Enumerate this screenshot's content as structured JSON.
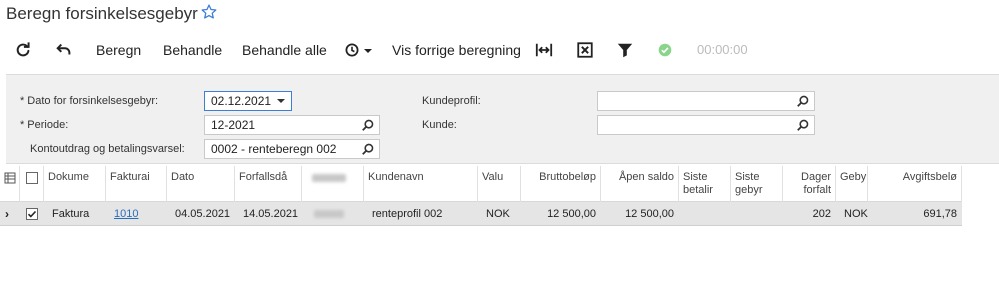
{
  "header": {
    "title": "Beregn forsinkelsesgebyr"
  },
  "toolbar": {
    "refresh_icon": "refresh-icon",
    "undo_icon": "undo-icon",
    "beregn_label": "Beregn",
    "behandle_label": "Behandle",
    "behandle_alle_label": "Behandle alle",
    "schedule_icon": "schedule-icon",
    "vis_forrige_label": "Vis forrige beregning",
    "fit_icon": "fit-columns-icon",
    "export_icon": "export-excel-icon",
    "filter_icon": "filter-icon",
    "status_icon": "check-circle-icon",
    "timer": "00:00:00"
  },
  "form": {
    "dato_label": "Dato for forsinkelsesgebyr:",
    "dato_value": "02.12.2021",
    "periode_label": "Periode:",
    "periode_value": "12-2021",
    "kontoutdrag_label": "Kontoutdrag og betalingsvarsel:",
    "kontoutdrag_value": "0002 - renteberegn 002",
    "kundeprofil_label": "Kundeprofil:",
    "kundeprofil_value": "",
    "kunde_label": "Kunde:",
    "kunde_value": "",
    "required_marker": "*"
  },
  "grid": {
    "columns": {
      "dokument": "Dokume",
      "faktura": "Fakturai",
      "dato": "Dato",
      "forfall": "Forfallsdå",
      "kundenavn": "Kundenavn",
      "valuta": "Valu",
      "brutto": "Bruttobeløp",
      "apen": "Åpen saldo",
      "siste_betaling": "Siste betalir",
      "siste_gebyr": "Siste gebyr",
      "dager": "Dager forfalt",
      "gebyr": "Geby",
      "avgift": "Avgiftsbelø"
    },
    "rows": [
      {
        "selected": true,
        "dokument": "Faktura",
        "faktura": "1010",
        "dato": "04.05.2021",
        "forfall": "14.05.2021",
        "kundenavn": "renteprofil 002",
        "valuta": "NOK",
        "brutto": "12 500,00",
        "apen": "12 500,00",
        "siste_betaling": "",
        "siste_gebyr": "",
        "dager": "202",
        "gebyr": "NOK",
        "avgift": "691,78"
      }
    ]
  },
  "colors": {
    "accent": "#3d7fd6",
    "link": "#2a6ebb",
    "panel_bg": "#f0f0f0",
    "row_selected_bg": "#e5e5e5",
    "status_ok": "#8bd48b"
  }
}
